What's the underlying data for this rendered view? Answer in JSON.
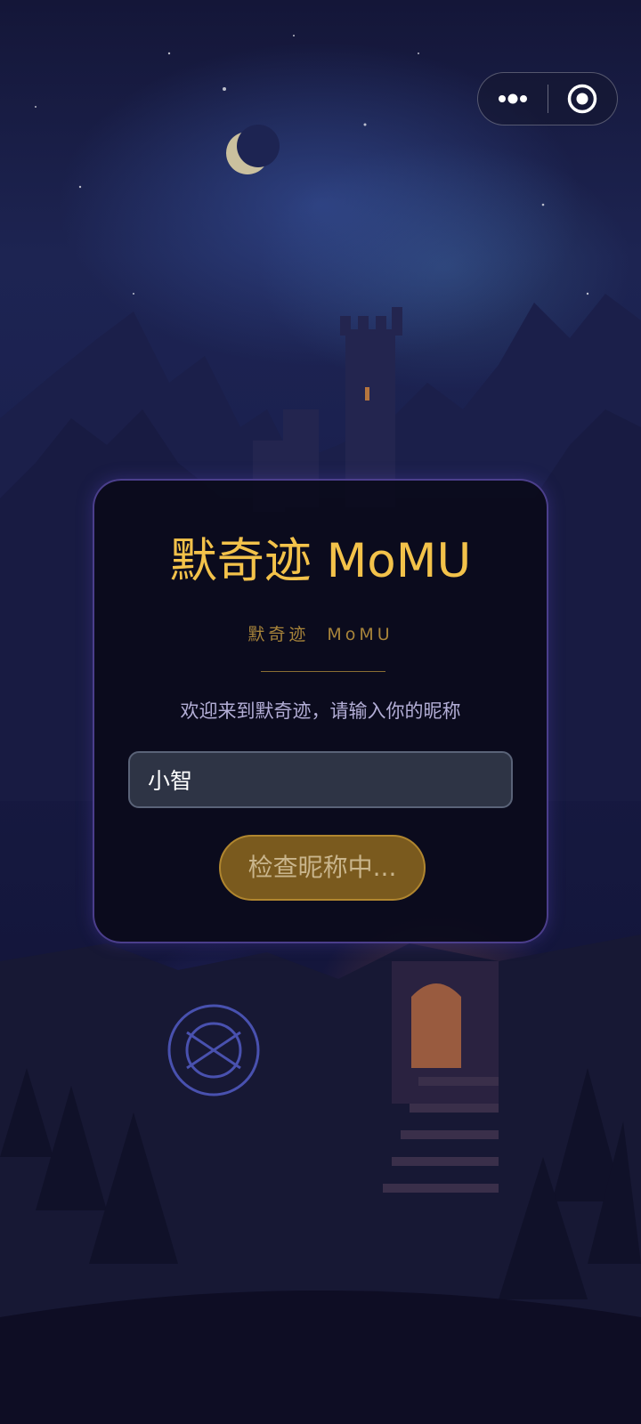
{
  "capsule": {
    "more_icon": "more-dots-icon",
    "close_icon": "target-circle-icon"
  },
  "card": {
    "title": "默奇迹 MoMU",
    "subtitle": "默奇迹  MoMU",
    "prompt": "欢迎来到默奇迹，请输入你的昵称",
    "nickname_value": "小智",
    "button_label": "检查昵称中..."
  },
  "colors": {
    "accent_gold": "#f3c24a",
    "button_bg": "#7a5a1e",
    "card_border": "#6e5ac8",
    "background": "#15183e"
  }
}
